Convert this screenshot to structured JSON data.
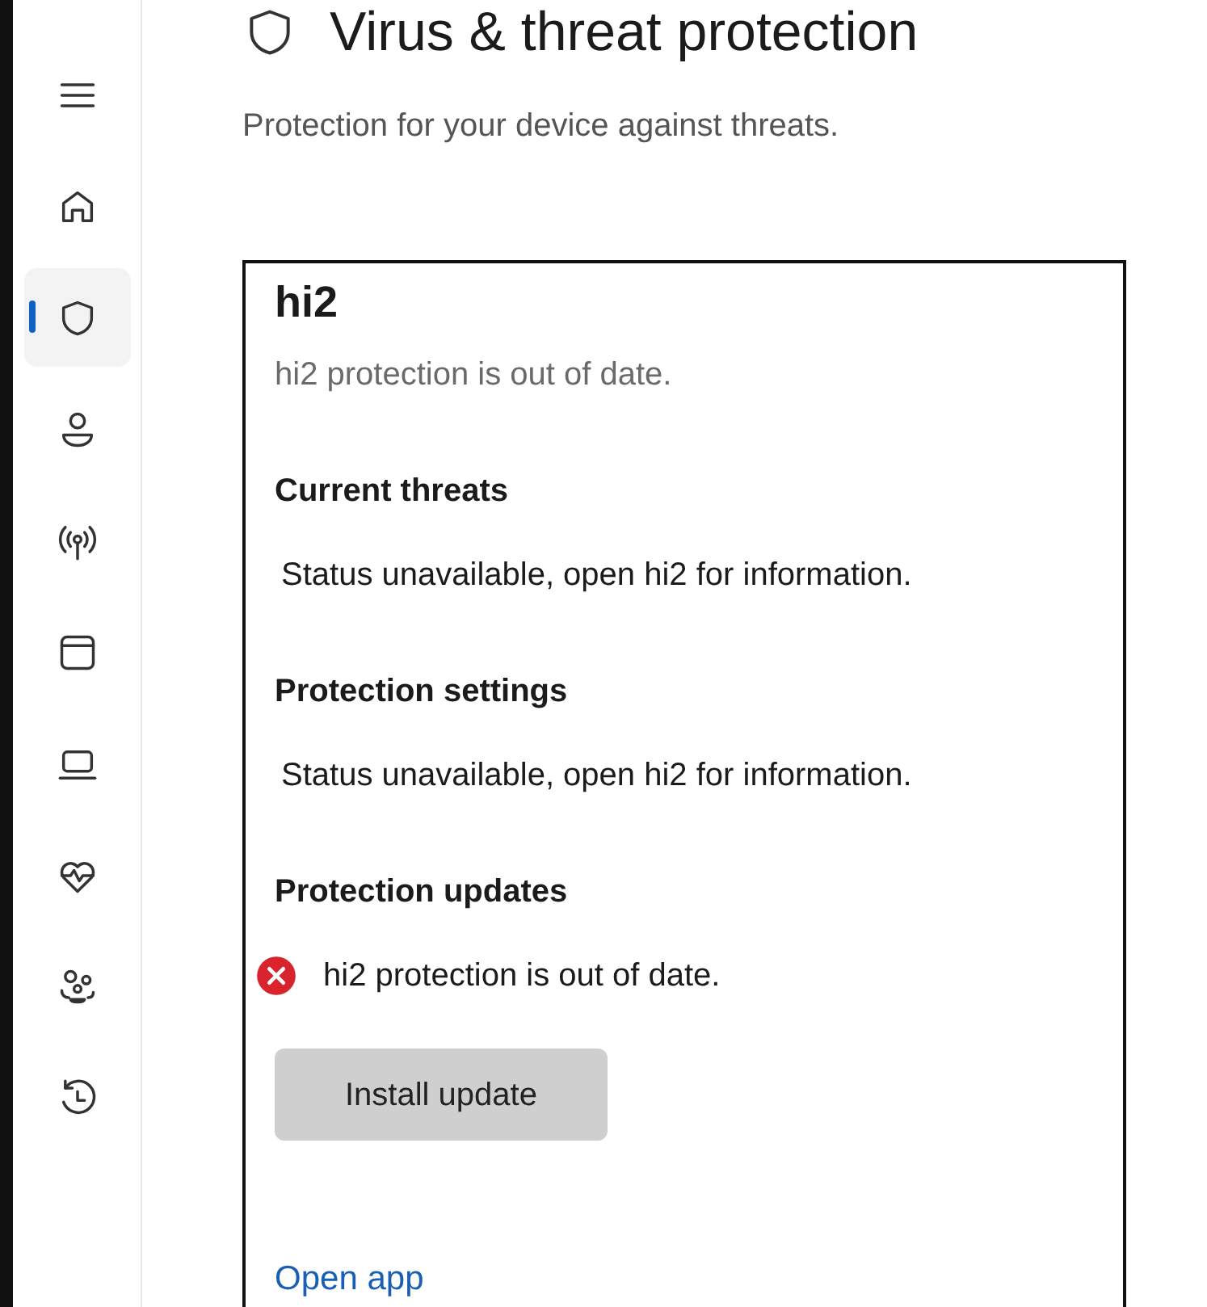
{
  "page": {
    "title": "Virus & threat protection",
    "subtitle": "Protection for your device against threats."
  },
  "sidebar": {
    "items": [
      {
        "kind": "menu",
        "selected": false
      },
      {
        "kind": "home",
        "selected": false
      },
      {
        "kind": "shield",
        "selected": true
      },
      {
        "kind": "person",
        "selected": false
      },
      {
        "kind": "antenna",
        "selected": false
      },
      {
        "kind": "window",
        "selected": false
      },
      {
        "kind": "laptop",
        "selected": false
      },
      {
        "kind": "heart",
        "selected": false
      },
      {
        "kind": "family",
        "selected": false
      },
      {
        "kind": "history",
        "selected": false
      }
    ]
  },
  "provider_card": {
    "name": "hi2",
    "summary": "hi2 protection is out of date.",
    "sections": [
      {
        "heading": "Current threats",
        "text": "Status unavailable, open hi2 for information.",
        "error": false
      },
      {
        "heading": "Protection settings",
        "text": "Status unavailable, open hi2 for information.",
        "error": false
      },
      {
        "heading": "Protection updates",
        "text": "hi2 protection is out of date.",
        "error": true
      }
    ],
    "button": "Install update",
    "link": "Open app"
  }
}
